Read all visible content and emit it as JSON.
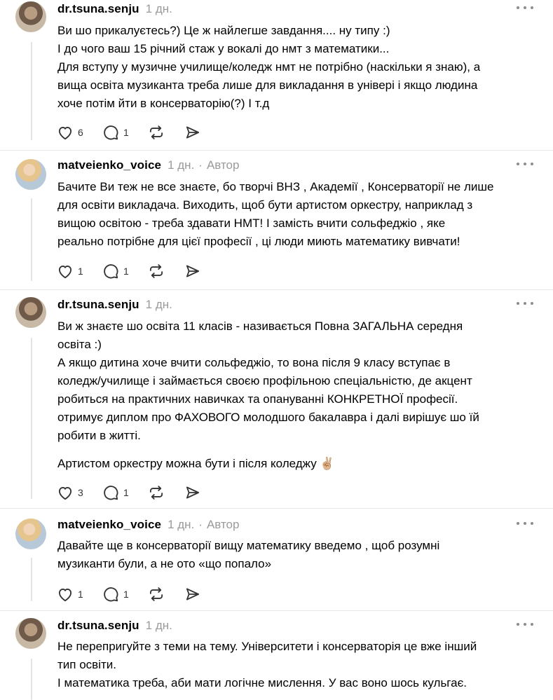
{
  "posts": [
    {
      "username": "dr.tsuna.senju",
      "time": "1 дн.",
      "badge": "",
      "avatar": "avatar-dr-tsuna",
      "lines": [
        "Ви шо прикалуєтесь?) Це ж найлегше завдання.... ну типу :)",
        "І до чого ваш 15 річний стаж у вокалі до нмт з математики...",
        "Для вступу у музичне училище/коледж нмт не потрібно (наскільки я знаю), а",
        "вища освіта музиканта треба лише для викладання в універі і якщо людина",
        "хоче потім йти в консерваторію(?) І т.д"
      ],
      "likes": "6",
      "replies": "1"
    },
    {
      "username": "matveienko_voice",
      "time": "1 дн.",
      "badge": "Автор",
      "avatar": "avatar-matveienko",
      "lines": [
        "Бачите Ви теж не все знаєте, бо творчі ВНЗ , Академії , Консерваторії не лише",
        "для освіти викладача. Виходить, щоб бути артистом оркестру, наприклад з",
        "вищою освітою - треба здавати НМТ! І замість вчити сольфеджіо , яке",
        "реально потрібне для цієї професії , ці люди миють математику вивчати!"
      ],
      "likes": "1",
      "replies": "1"
    },
    {
      "username": "dr.tsuna.senju",
      "time": "1 дн.",
      "badge": "",
      "avatar": "avatar-dr-tsuna",
      "lines": [
        "Ви ж знаєте шо освіта 11 класів - називається Повна ЗАГАЛЬНА середня",
        "освіта :)",
        "А якщо дитина хоче вчити сольфеджіо, то вона після 9 класу вступає в",
        "коледж/училище і займається своєю профільною спеціальністю, де акцент",
        "робиться на практичних навичках та опануванні КОНКРЕТНОЇ професії.",
        "отримує диплом про ФАХОВОГО молодшого бакалавра і далі вирішує шо їй",
        "робити в житті."
      ],
      "extra_line": "Артистом оркестру можна бути і після коледжу ✌🏼",
      "likes": "3",
      "replies": "1"
    },
    {
      "username": "matveienko_voice",
      "time": "1 дн.",
      "badge": "Автор",
      "avatar": "avatar-matveienko",
      "lines": [
        "Давайте ще в консерваторії вищу математику введемо , щоб розумні",
        "музиканти були, а не ото «що попало»"
      ],
      "likes": "1",
      "replies": "1"
    },
    {
      "username": "dr.tsuna.senju",
      "time": "1 дн.",
      "badge": "",
      "avatar": "avatar-dr-tsuna",
      "lines": [
        "Не перепригуйте з теми на тему. Університети і консерваторія це вже інший",
        "тип освіти.",
        "І математика треба, аби мати логічне мислення. У вас воно шось кульгає."
      ]
    }
  ],
  "icons": {
    "like": "heart-icon",
    "reply": "comment-icon",
    "repost": "repost-icon",
    "share": "send-icon",
    "more": "more-dots-icon"
  },
  "colors": {
    "text": "#000000",
    "meta": "#9a9a9a",
    "icon": "#333333",
    "divider": "#e6e6e6",
    "thread_line": "#e3e3e3"
  }
}
